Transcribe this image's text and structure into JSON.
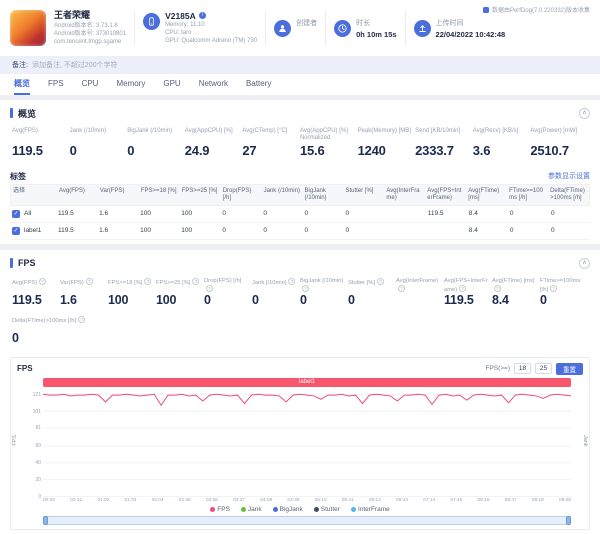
{
  "meta": {
    "collector": "数据由PerfDog(7.0.220332)版本收集"
  },
  "header": {
    "app": {
      "name": "王者荣耀",
      "version_line1": "Android版本名: 3.73.1.8",
      "version_line2": "Android版本号: 373010801",
      "package": "com.tencent.tmgp.sgame"
    },
    "device": {
      "model": "V2185A",
      "memory": "Memory: 11.10",
      "cpu": "CPU: taro",
      "gpu": "GPU: Qualcomm Adreno (TM) 730"
    },
    "creator": {
      "label": "创建者",
      "value": ""
    },
    "duration": {
      "label": "时长",
      "value": "0h 10m 15s"
    },
    "upload": {
      "label": "上传时间",
      "value": "22/04/2022 10:42:48"
    }
  },
  "note": {
    "prefix": "备注:",
    "placeholder": "添加备注, 不超过200个字符"
  },
  "tabs": [
    {
      "label": "概览",
      "active": true
    },
    {
      "label": "FPS",
      "active": false
    },
    {
      "label": "CPU",
      "active": false
    },
    {
      "label": "Memory",
      "active": false
    },
    {
      "label": "GPU",
      "active": false
    },
    {
      "label": "Network",
      "active": false
    },
    {
      "label": "Battery",
      "active": false
    }
  ],
  "overview": {
    "title": "概览",
    "stats": [
      {
        "label": "Avg(FPS)",
        "value": "119.5"
      },
      {
        "label": "Jank (/10min)",
        "value": "0"
      },
      {
        "label": "BigJank (/10min)",
        "value": "0"
      },
      {
        "label": "Avg(AppCPU) [%]",
        "value": "24.9"
      },
      {
        "label": "Avg(CTemp) [°C]",
        "value": "27"
      },
      {
        "label": "Avg(AppCPU) [%] Normalized",
        "value": "15.6"
      },
      {
        "label": "Peak(Memory) [MB]",
        "value": "1240"
      },
      {
        "label": "Send [KB/10min]",
        "value": "2333.7"
      },
      {
        "label": "Avg(Recv) [KB/s]",
        "value": "3.6"
      },
      {
        "label": "Avg(Power) [mW]",
        "value": "2510.7"
      }
    ]
  },
  "labels_table": {
    "title": "标签",
    "settings_link": "参数显示设置",
    "columns": [
      "选择",
      "Avg(FPS)",
      "Var(FPS)",
      "FPS>=18 [%]",
      "FPS>=25 [%]",
      "Drop(FPS) [/h]",
      "Jank (/10min)",
      "BigJank (/10min)",
      "Stutter [%]",
      "Avg(InterFrame)",
      "Avg(FPS+InterFrame)",
      "Avg(FTime) [ms]",
      "FTime>=100ms [/h]",
      "Delta(FTime)>100ms [/h]"
    ],
    "rows": [
      {
        "name": "All",
        "checked": true,
        "values": [
          "119.5",
          "1.6",
          "100",
          "100",
          "0",
          "0",
          "0",
          "0",
          "",
          "119.5",
          "8.4",
          "0",
          "0"
        ]
      },
      {
        "name": "label1",
        "checked": true,
        "values": [
          "119.5",
          "1.6",
          "100",
          "100",
          "0",
          "0",
          "0",
          "0",
          "",
          "",
          "8.4",
          "0",
          "0"
        ]
      }
    ]
  },
  "fps_section": {
    "title": "FPS",
    "stats": [
      {
        "label": "Avg(FPS)",
        "value": "119.5"
      },
      {
        "label": "Var(FPS)",
        "value": "1.6"
      },
      {
        "label": "FPS>=18 [%]",
        "value": "100"
      },
      {
        "label": "FPS>=25 [%]",
        "value": "100"
      },
      {
        "label": "Drop(FPS) [/h]",
        "value": "0"
      },
      {
        "label": "Jank [/10min]",
        "value": "0"
      },
      {
        "label": "BigJank [/10min]",
        "value": "0"
      },
      {
        "label": "Stutter [%]",
        "value": "0"
      },
      {
        "label": "Avg(InterFrame)",
        "value": ""
      },
      {
        "label": "Avg(FPS+InterFrame)",
        "value": "119.5"
      },
      {
        "label": "Avg(FTime) [ms]",
        "value": "8.4"
      },
      {
        "label": "FTime>=100ms [/h]",
        "value": "0"
      }
    ],
    "stats2": [
      {
        "label": "Delta(FTime)>100ms [/h]",
        "value": "0"
      }
    ]
  },
  "chart": {
    "title": "FPS",
    "threshold_label": "FPS(>=)",
    "threshold1": "18",
    "threshold2": "25",
    "reset_button": "重置",
    "banner": "label1",
    "y_left_label": "FPS",
    "y_right_label": "Jank",
    "legend": [
      {
        "name": "FPS",
        "color": "#ee4b80"
      },
      {
        "name": "Jank",
        "color": "#67c23a"
      },
      {
        "name": "BigJank",
        "color": "#4a6edb"
      },
      {
        "name": "Stutter",
        "color": "#404a6b"
      },
      {
        "name": "InterFrame",
        "color": "#56b7e6"
      }
    ]
  },
  "chart_data": {
    "type": "line",
    "title": "FPS",
    "xlabel": "",
    "ylabel": "FPS",
    "ylabel_right": "Jank",
    "ylim": [
      0,
      126
    ],
    "y_ticks": [
      121,
      101,
      81,
      60,
      40,
      20,
      0
    ],
    "x_ticks": [
      "00:00",
      "00:31",
      "01:02",
      "01:33",
      "02:04",
      "02:35",
      "03:06",
      "03:37",
      "04:08",
      "04:39",
      "05:10",
      "05:41",
      "06:12",
      "06:43",
      "07:14",
      "07:45",
      "08:16",
      "08:47",
      "09:18",
      "09:48"
    ],
    "legend_position": "bottom",
    "grid": true,
    "series": [
      {
        "name": "FPS",
        "color": "#ee4b80",
        "values": [
          121,
          120,
          120,
          121,
          119,
          120,
          120,
          121,
          120,
          112,
          120,
          120,
          121,
          120,
          119,
          120,
          121,
          108,
          120,
          120,
          121,
          119,
          120,
          113,
          120,
          121,
          120,
          119,
          120,
          110,
          120,
          121,
          120,
          120,
          119,
          112,
          120,
          121,
          120,
          119,
          115,
          120,
          120,
          121,
          119,
          120,
          110,
          120,
          121,
          120,
          119,
          113,
          120,
          120,
          121,
          120,
          109,
          120,
          121,
          119,
          120,
          114,
          120,
          121,
          120,
          119,
          120,
          111,
          120,
          121,
          120,
          119,
          116,
          120,
          121,
          120,
          119
        ]
      }
    ]
  }
}
